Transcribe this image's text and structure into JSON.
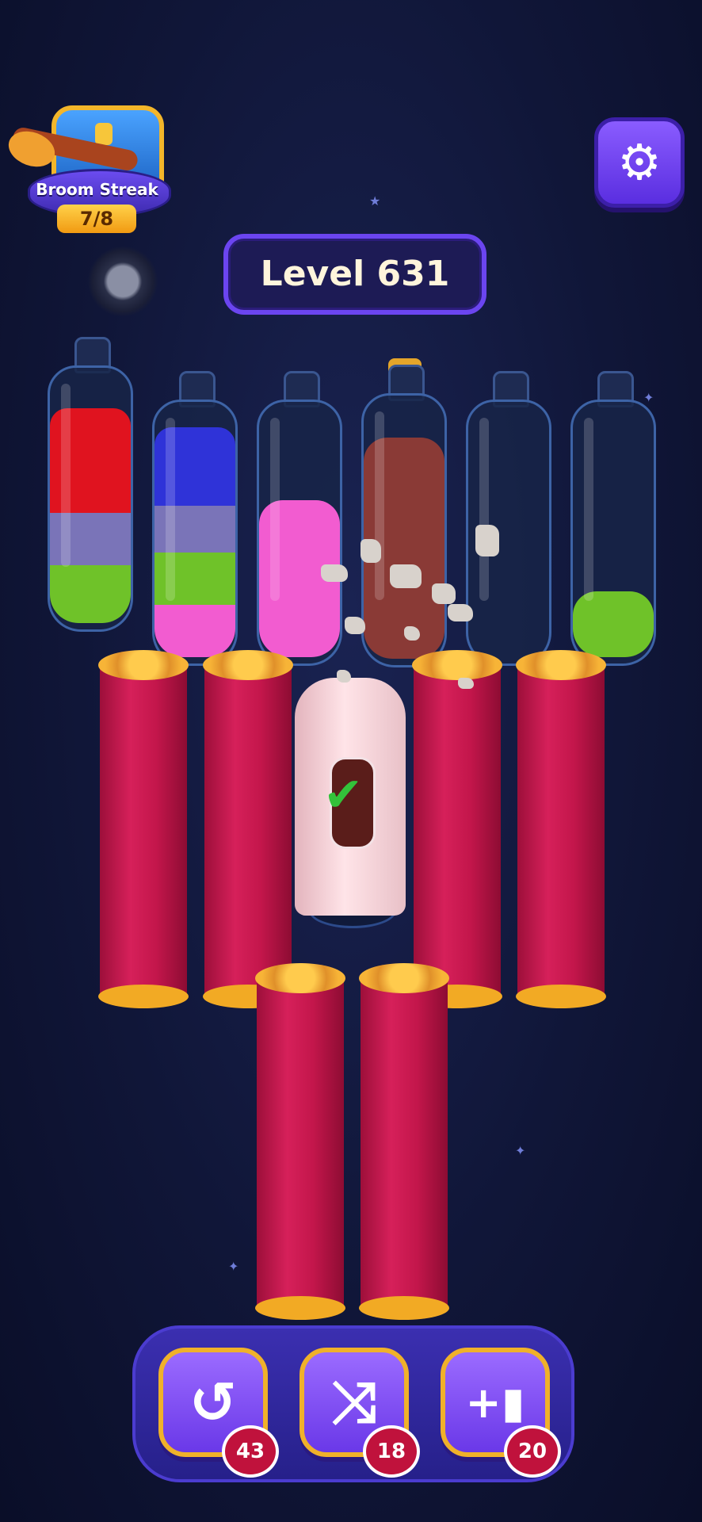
{
  "streak": {
    "label": "Broom Streak",
    "count": "7/8"
  },
  "level": {
    "label": "Level 631"
  },
  "settings": {
    "icon": "gear-icon",
    "glyph": "⚙"
  },
  "bottles": [
    {
      "id": 1,
      "colors": [
        "#e0131f",
        "#7a74b8",
        "#6fc229"
      ]
    },
    {
      "id": 2,
      "colors": [
        "#2f33d8",
        "#7a74b8",
        "#6fc229",
        "#f25cd0"
      ]
    },
    {
      "id": 3,
      "colors": [
        "#f25cd0"
      ]
    },
    {
      "id": 4,
      "colors": [
        "#8a3a36"
      ],
      "corked": true
    },
    {
      "id": 5,
      "colors": []
    },
    {
      "id": 6,
      "colors": [
        "#6fc229"
      ]
    }
  ],
  "powerups": [
    {
      "name": "undo",
      "icon": "undo-icon",
      "glyph": "↺",
      "count": "43"
    },
    {
      "name": "shuffle",
      "icon": "shuffle-icon",
      "glyph": "⤨",
      "count": "18"
    },
    {
      "name": "add-bottle",
      "icon": "add-bottle-icon",
      "glyph": "+▮",
      "count": "20"
    }
  ]
}
